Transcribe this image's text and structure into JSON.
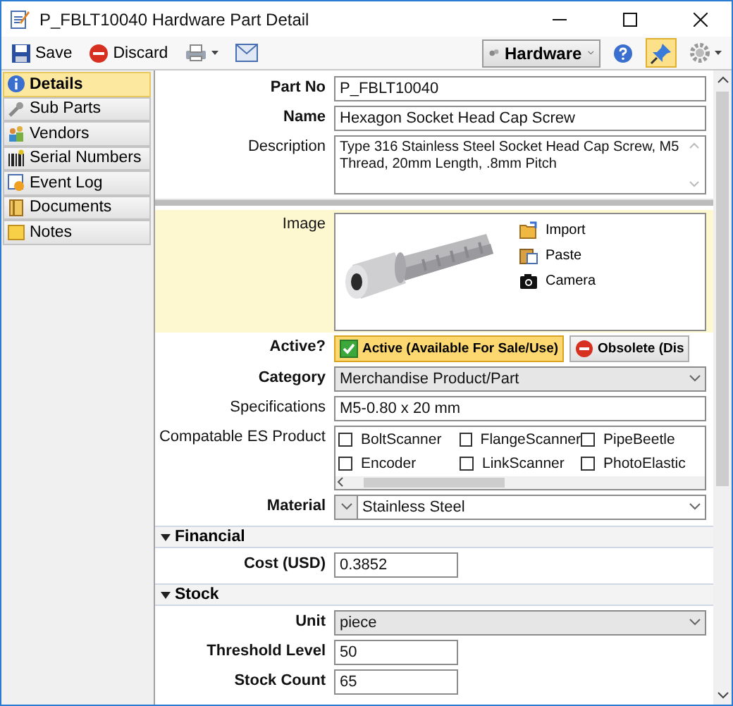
{
  "window": {
    "title": "P_FBLT10040 Hardware Part Detail"
  },
  "toolbar": {
    "buttons": [
      {
        "label": "Save",
        "kind": "save"
      },
      {
        "label": "Discard",
        "kind": "discard"
      }
    ],
    "type_dropdown": {
      "value": "Hardware"
    },
    "pin_selected": true
  },
  "sidebar": {
    "items": [
      {
        "label": "Details",
        "kind": "info",
        "selected": true
      },
      {
        "label": "Sub Parts",
        "kind": "wrench",
        "selected": false
      },
      {
        "label": "Vendors",
        "kind": "vendors",
        "selected": false
      },
      {
        "label": "Serial Numbers",
        "kind": "barcode",
        "selected": false
      },
      {
        "label": "Event Log",
        "kind": "log",
        "selected": false
      },
      {
        "label": "Documents",
        "kind": "docs",
        "selected": false
      },
      {
        "label": "Notes",
        "kind": "note",
        "selected": false
      }
    ]
  },
  "form": {
    "rows": [
      {
        "kind": "text",
        "label": "Part No",
        "required": true,
        "value": "P_FBLT10040"
      },
      {
        "kind": "text",
        "label": "Name",
        "required": true,
        "value": "Hexagon Socket Head Cap Screw"
      },
      {
        "kind": "textarea",
        "label": "Description",
        "required": false,
        "value": "Type 316 Stainless Steel Socket Head Cap Screw, M5 Thread, 20mm Length, .8mm Pitch"
      },
      {
        "label": "Image",
        "required": false,
        "highlighted": true,
        "actions": [
          {
            "label": "Import",
            "kind": "import"
          },
          {
            "label": "Paste",
            "kind": "paste"
          },
          {
            "label": "Camera",
            "kind": "camera"
          }
        ]
      },
      {
        "kind": "toggle",
        "label": "Active?",
        "required": true,
        "options": [
          {
            "label": "Active (Available For Sale/Use)",
            "kind": "active",
            "selected": true
          },
          {
            "label": "Obsolete (Dis",
            "kind": "obsolete",
            "selected": false
          }
        ]
      },
      {
        "kind": "select",
        "label": "Category",
        "required": true,
        "value": "Merchandise Product/Part"
      },
      {
        "kind": "text",
        "label": "Specifications",
        "required": false,
        "value": "M5-0.80 x 20 mm"
      },
      {
        "kind": "checks",
        "label": "Compatable ES Product",
        "required": false,
        "items": [
          {
            "label": "BoltScanner",
            "checked": false
          },
          {
            "label": "FlangeScanner",
            "checked": false
          },
          {
            "label": "PipeBeetle",
            "checked": false
          },
          {
            "label": "Encoder",
            "checked": false
          },
          {
            "label": "LinkScanner",
            "checked": false
          },
          {
            "label": "PhotoElastic",
            "checked": false
          }
        ]
      },
      {
        "kind": "material",
        "label": "Material",
        "required": true,
        "value": "Stainless Steel"
      },
      {
        "kind": "section",
        "label": "Financial",
        "expanded": true
      },
      {
        "kind": "short",
        "label": "Cost (USD)",
        "required": true,
        "value": "0.3852"
      },
      {
        "kind": "section",
        "label": "Stock",
        "expanded": true
      },
      {
        "kind": "select",
        "label": "Unit",
        "required": true,
        "value": "piece"
      },
      {
        "kind": "short",
        "label": "Threshold Level",
        "required": true,
        "value": "50"
      },
      {
        "kind": "short",
        "label": "Stock Count",
        "required": true,
        "value": "65"
      }
    ]
  }
}
